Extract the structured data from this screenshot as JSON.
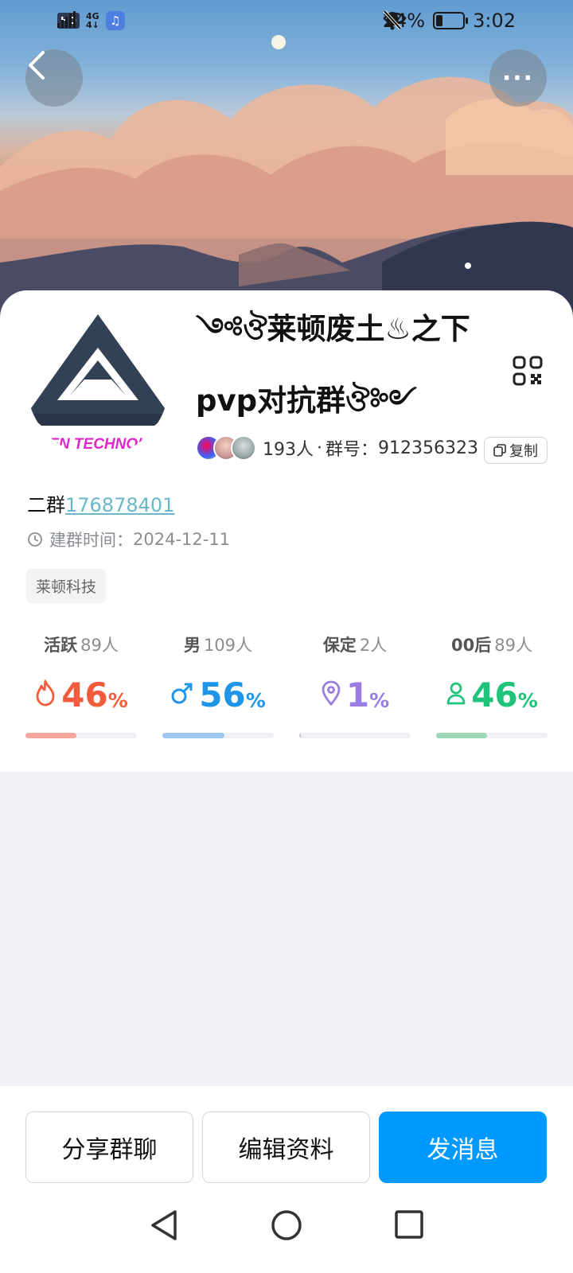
{
  "status_bar": {
    "hd": "HD",
    "net_top": "4G",
    "net_bottom": "4↓",
    "battery_text": "24%",
    "battery_level": 0.24,
    "time": "3:02"
  },
  "header": {
    "back_icon": "chevron-left-icon",
    "more_icon": "more-horizontal-icon",
    "more_label": "···"
  },
  "group": {
    "name_line1": "༺ঔ莱顿废土♨之下",
    "name_line2": "pvp对抗群ঔ༻",
    "logo_caption": "DEN TECHNOLC",
    "member_count": "193人",
    "separator": "·",
    "group_no_label": "群号：",
    "group_no": "912356323",
    "copy_label": "复制",
    "desc_prefix": "二群",
    "desc_link": "176878401",
    "created_label": "建群时间：",
    "created_date": "2024-12-11",
    "tag": "莱顿科技"
  },
  "stats": [
    {
      "label": "活跃",
      "count": "89人",
      "value": "46",
      "unit": "%",
      "color": "#f25c3d",
      "bar_color": "#f4a79a",
      "fraction": 0.46,
      "icon": "flame-icon"
    },
    {
      "label": "男",
      "count": "109人",
      "value": "56",
      "unit": "%",
      "color": "#1f95e8",
      "bar_color": "#9ec8f2",
      "fraction": 0.56,
      "icon": "male-icon"
    },
    {
      "label": "保定",
      "count": "2人",
      "value": "1",
      "unit": "%",
      "color": "#9a7de0",
      "bar_color": "#c9c9d4",
      "fraction": 0.01,
      "icon": "location-pin-icon"
    },
    {
      "label": "00后",
      "count": "89人",
      "value": "46",
      "unit": "%",
      "color": "#1fc47a",
      "bar_color": "#9ad8b6",
      "fraction": 0.46,
      "icon": "person-icon"
    }
  ],
  "actions": {
    "share": "分享群聊",
    "edit": "编辑资料",
    "message": "发消息"
  },
  "colors": {
    "primary": "#0099ff",
    "link": "#68b8c8",
    "background": "#f0f1f6"
  }
}
